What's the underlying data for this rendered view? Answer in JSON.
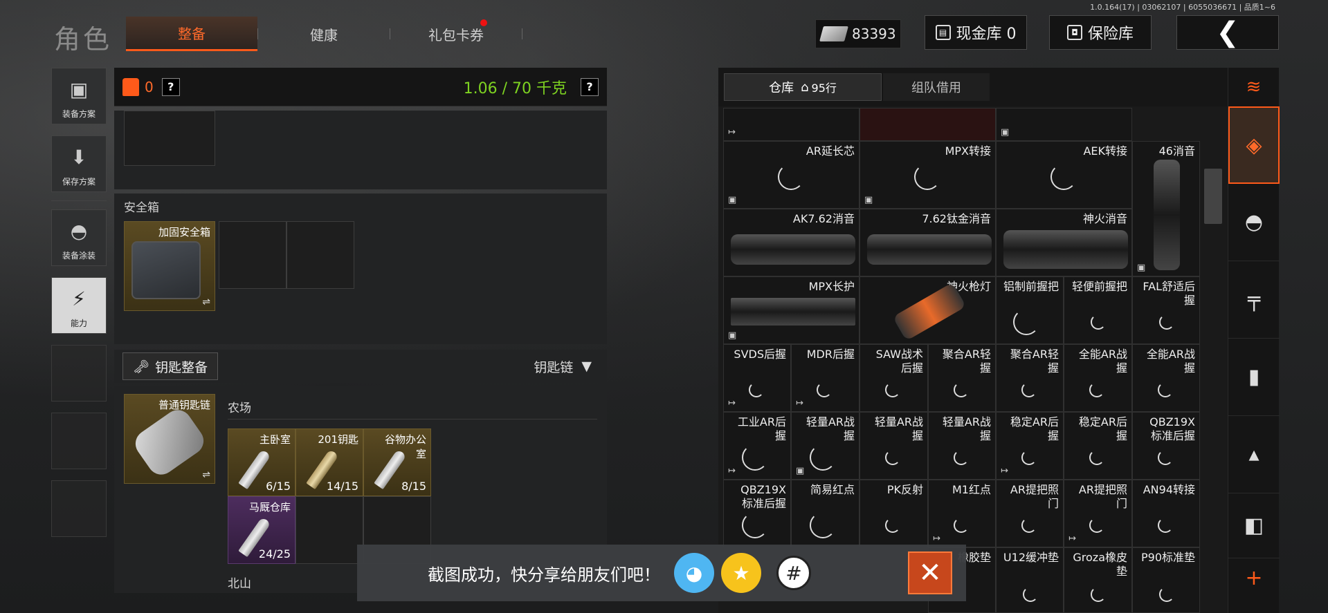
{
  "header": {
    "version": "1.0.164(17) | 03062107 | 6055036671 | 品质1~6",
    "title": "角色",
    "tabs": [
      "整备",
      "健康",
      "礼包卡券"
    ],
    "cash": "83393",
    "cash_vault": "现金库 0",
    "safe_vault": "保险库",
    "back": "❮"
  },
  "left_nav": [
    {
      "label": "装备方案",
      "icon": "vest-icon"
    },
    {
      "label": "保存方案",
      "icon": "download-icon"
    },
    {
      "label": "装备涂装",
      "icon": "helmet-icon"
    },
    {
      "label": "能力",
      "icon": "ability-icon"
    }
  ],
  "equipment": {
    "backpack_count": "0",
    "help": "?",
    "weight": "1.06 / 70 千克",
    "safebox_title": "安全箱",
    "safebox_item": "加固安全箱",
    "swap": "⇌",
    "keys_button": "钥匙整备",
    "keychain_label": "钥匙链",
    "keychain_item": "普通钥匙链",
    "area1": "农场",
    "area2": "北山",
    "keys": [
      {
        "name": "主卧室",
        "count": "6/15"
      },
      {
        "name": "201钥匙",
        "count": "14/15"
      },
      {
        "name": "谷物办公室",
        "count": "8/15"
      },
      {
        "name": "马厩仓库",
        "count": "24/25"
      }
    ]
  },
  "warehouse": {
    "tab_main": "仓库",
    "rows": "95行",
    "tab_team": "组队借用",
    "items": {
      "r1": [
        "AR延长芯",
        "MPX转接",
        "AEK转接",
        "46消音"
      ],
      "r2": [
        "AK7.62消音",
        "7.62钛金消音",
        "神火消音"
      ],
      "r3": [
        "MPX长护",
        "神火枪灯",
        "铝制前握把",
        "轻便前握把",
        "FAL舒适后握"
      ],
      "r4": [
        "SVDS后握",
        "MDR后握",
        "SAW战术后握",
        "聚合AR轻握",
        "聚合AR轻握",
        "全能AR战握",
        "全能AR战握"
      ],
      "r5": [
        "工业AR后握",
        "轻量AR战握",
        "轻量AR战握",
        "轻量AR战握",
        "稳定AR后握",
        "稳定AR后握",
        "QBZ19X标准后握"
      ],
      "r6": [
        "QBZ19X标准后握",
        "简易红点",
        "PK反射",
        "M1红点",
        "AR提把照门",
        "AR提把照门",
        "AN94转接"
      ],
      "r7": [
        "橡胶垫",
        "U12缓冲垫",
        "Groza橡皮垫",
        "P90标准垫"
      ]
    }
  },
  "toast": {
    "text": "截图成功，快分享给朋友们吧！",
    "close": "✕"
  }
}
